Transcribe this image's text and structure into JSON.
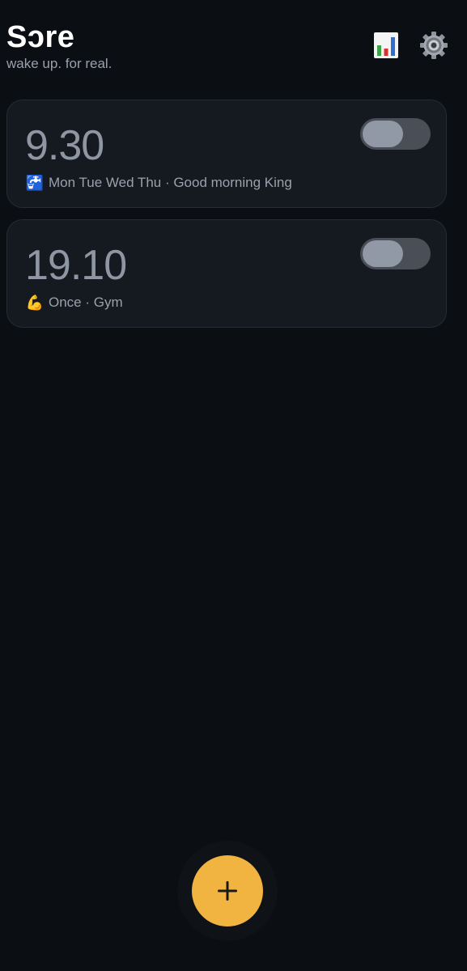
{
  "header": {
    "title": "Sɔre",
    "subtitle": "wake up. for real.",
    "stats_icon": "bar-chart-icon",
    "settings_icon": "gear-icon"
  },
  "alarms": [
    {
      "time": "9.30",
      "emoji": "🚰",
      "description": "Mon Tue Wed Thu · Good morning King",
      "enabled": false
    },
    {
      "time": "19.10",
      "emoji": "💪",
      "description": "Once · Gym",
      "enabled": false
    }
  ],
  "fab": {
    "icon": "plus-icon",
    "label": "+"
  },
  "colors": {
    "background": "#0b0e13",
    "card": "#151920",
    "accent": "#f2b441",
    "toggle_track": "#4a4e56",
    "toggle_knob": "#9198a6"
  }
}
